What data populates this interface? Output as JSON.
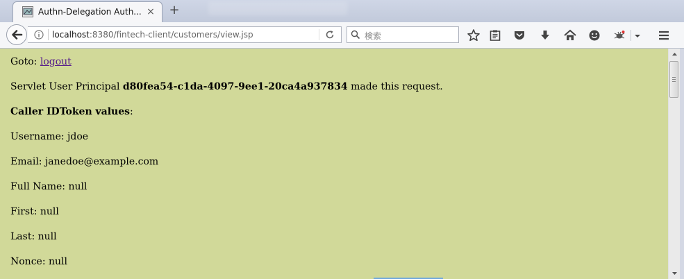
{
  "tab": {
    "title": "Authn-Delegation Auth...",
    "close_glyph": "×",
    "new_tab_glyph": "+"
  },
  "navbar": {
    "url_host": "localhost",
    "url_rest": ":8380/fintech-client/customers/view.jsp",
    "search_placeholder": "検索"
  },
  "page": {
    "goto_label": "Goto: ",
    "logout_link": "logout",
    "principal_prefix": "Servlet User Principal ",
    "principal_id": "d80fea54-c1da-4097-9ee1-20ca4a937834",
    "principal_suffix": " made this request.",
    "idtoken_heading": "Caller IDToken values",
    "idtoken_colon": ":",
    "username": "Username: jdoe",
    "email": "Email: janedoe@example.com",
    "full_name": "Full Name: null",
    "first": "First: null",
    "last": "Last: null",
    "nonce": "Nonce: null"
  },
  "colors": {
    "page_background": "#d1d999",
    "link": "#551a8b"
  },
  "icons": {
    "back": "back-arrow-icon",
    "info": "info-icon",
    "reload": "reload-icon",
    "search": "search-icon",
    "bookmark": "star-icon",
    "reading_list": "clipboard-icon",
    "pocket": "pocket-icon",
    "download": "download-arrow-icon",
    "home": "home-icon",
    "emoji": "smiley-icon",
    "addon": "bug-addon-icon",
    "menu": "hamburger-menu-icon"
  }
}
